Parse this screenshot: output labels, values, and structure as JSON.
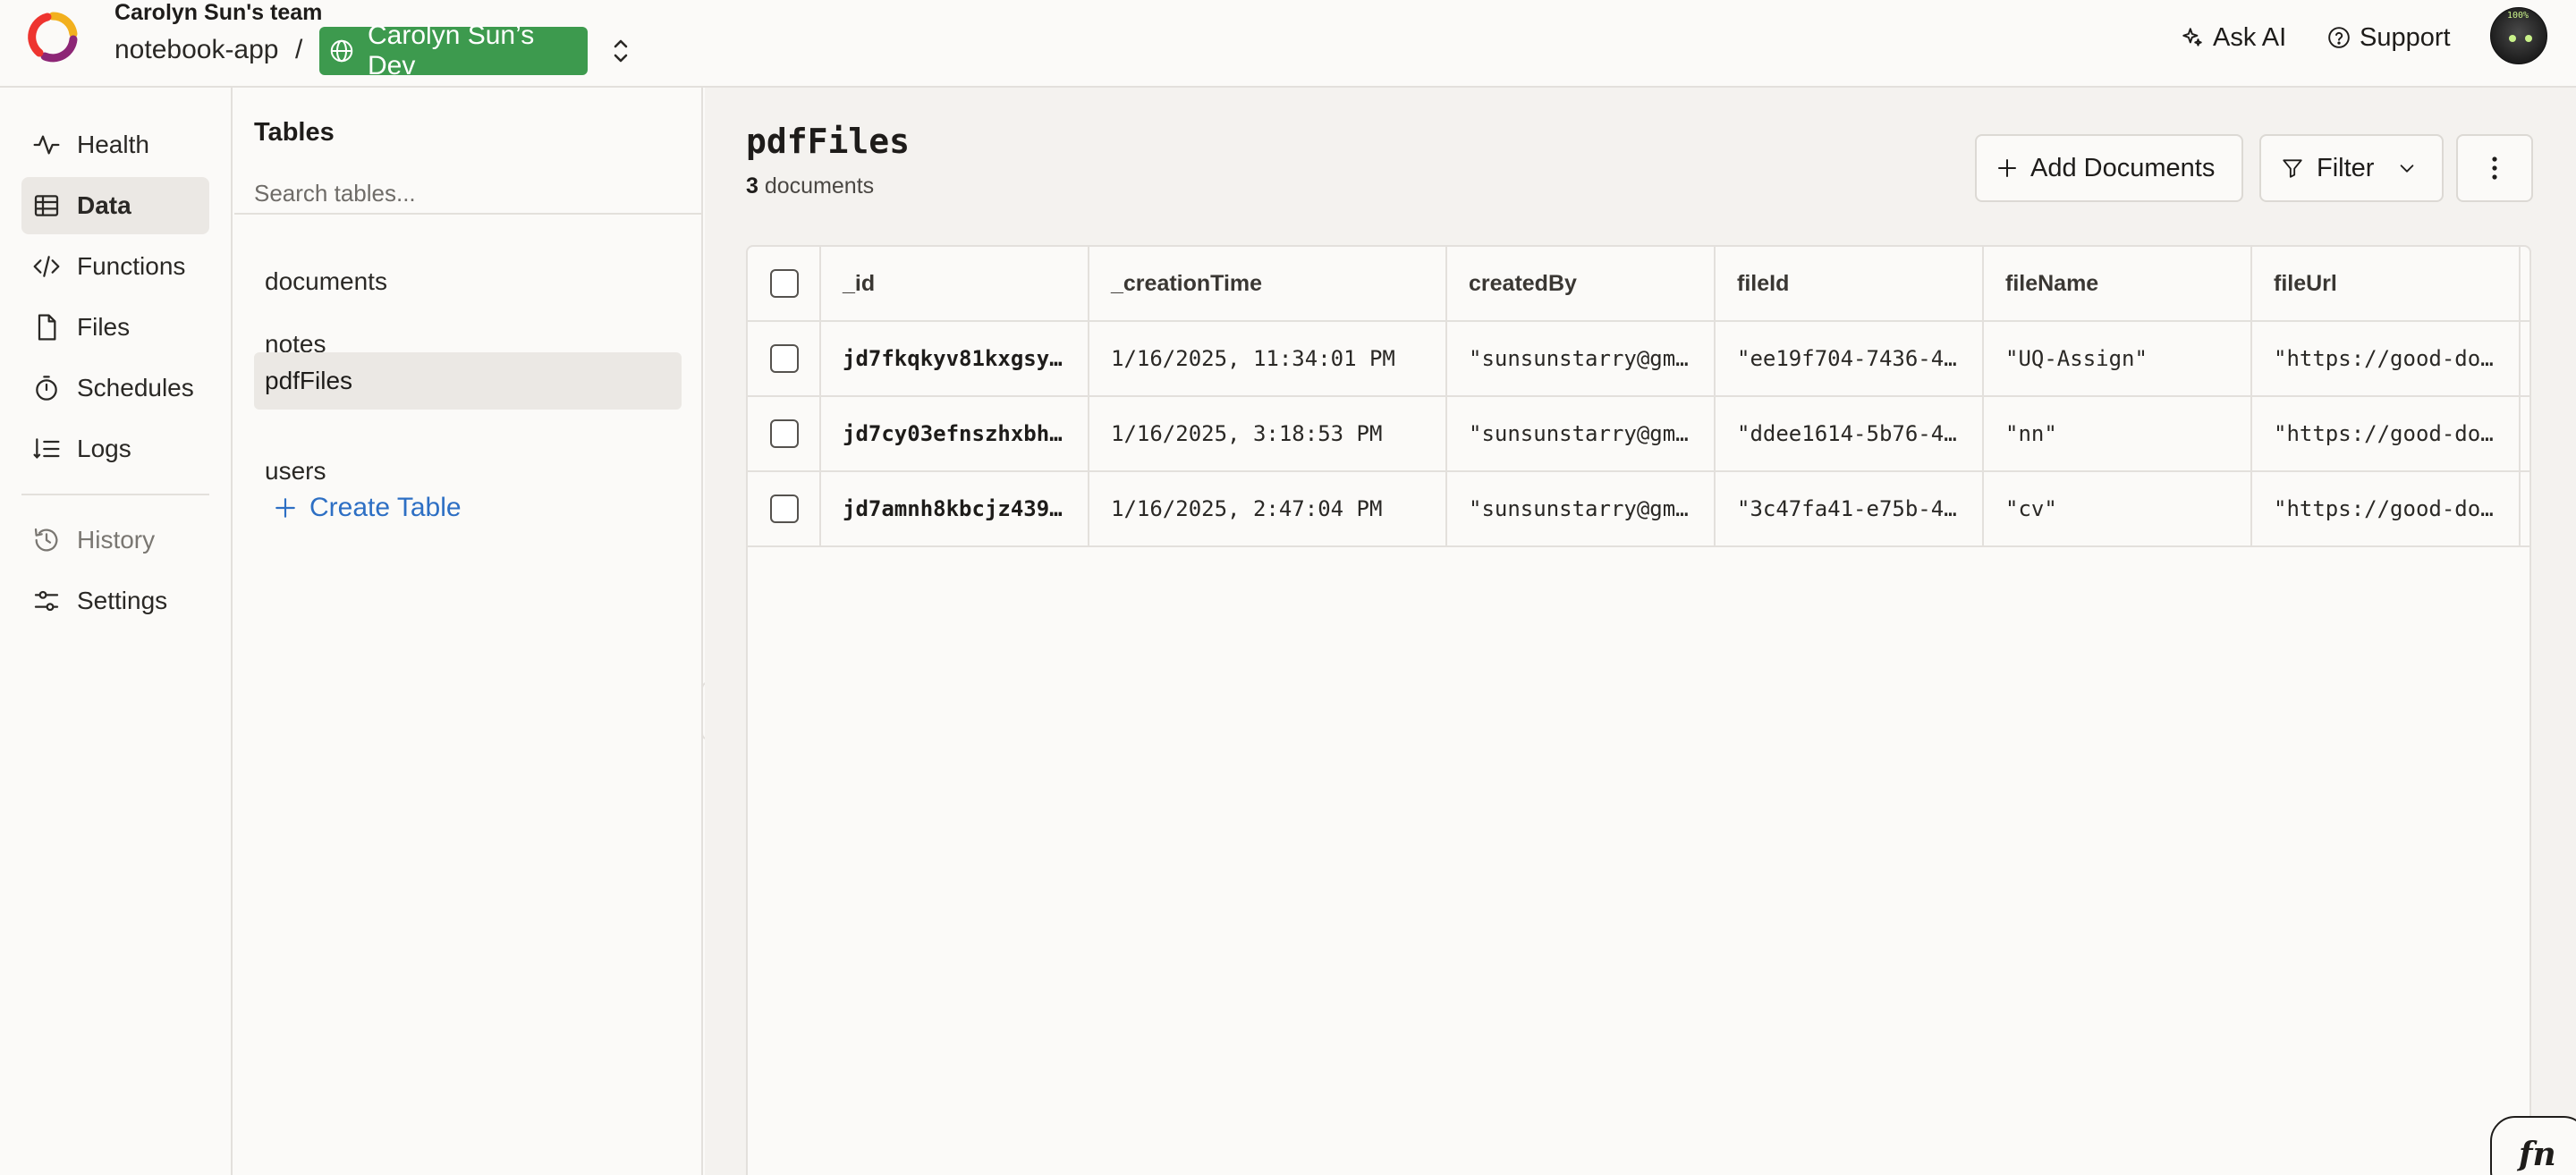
{
  "header": {
    "team_name": "Carolyn Sun's team",
    "project_name": "notebook-app",
    "separator": "/",
    "deployment": "Carolyn Sun’s Dev",
    "ask_ai": "Ask AI",
    "support": "Support",
    "avatar_badge": "100%"
  },
  "nav": {
    "items": [
      {
        "label": "Health",
        "icon": "pulse-icon"
      },
      {
        "label": "Data",
        "icon": "table-grid-icon",
        "active": true
      },
      {
        "label": "Functions",
        "icon": "code-icon"
      },
      {
        "label": "Files",
        "icon": "file-icon"
      },
      {
        "label": "Schedules",
        "icon": "stopwatch-icon"
      },
      {
        "label": "Logs",
        "icon": "logs-icon"
      },
      {
        "label": "History",
        "icon": "history-icon"
      },
      {
        "label": "Settings",
        "icon": "sliders-icon"
      }
    ]
  },
  "tables": {
    "title": "Tables",
    "search_placeholder": "Search tables...",
    "items": [
      "documents",
      "notes",
      "pdfFiles",
      "users"
    ],
    "selected": "pdfFiles",
    "create_label": "Create Table"
  },
  "main": {
    "title": "pdfFiles",
    "count": "3",
    "count_label": "documents",
    "add_documents": "Add Documents",
    "filter": "Filter",
    "columns": [
      "_id",
      "_creationTime",
      "createdBy",
      "fileId",
      "fileName",
      "fileUrl"
    ],
    "rows": [
      [
        "jd7fkqkyv81kxgsy…",
        "1/16/2025, 11:34:01 PM",
        "\"sunsunstarry@gm…",
        "\"ee19f704-7436-4…",
        "\"UQ-Assign\"",
        "\"https://good-do…"
      ],
      [
        "jd7cy03efnszhxbh…",
        "1/16/2025, 3:18:53 PM",
        "\"sunsunstarry@gm…",
        "\"ddee1614-5b76-4…",
        "\"nn\"",
        "\"https://good-do…"
      ],
      [
        "jd7amnh8kbcjz439…",
        "1/16/2025, 2:47:04 PM",
        "\"sunsunstarry@gm…",
        "\"3c47fa41-e75b-4…",
        "\"cv\"",
        "\"https://good-do…"
      ]
    ]
  },
  "fn_badge": "fn",
  "colors": {
    "deployment_green": "#3d9a4e",
    "link_blue": "#2d6fc4",
    "active_bg": "#ebe8e4",
    "main_bg": "#f4f2ef"
  }
}
